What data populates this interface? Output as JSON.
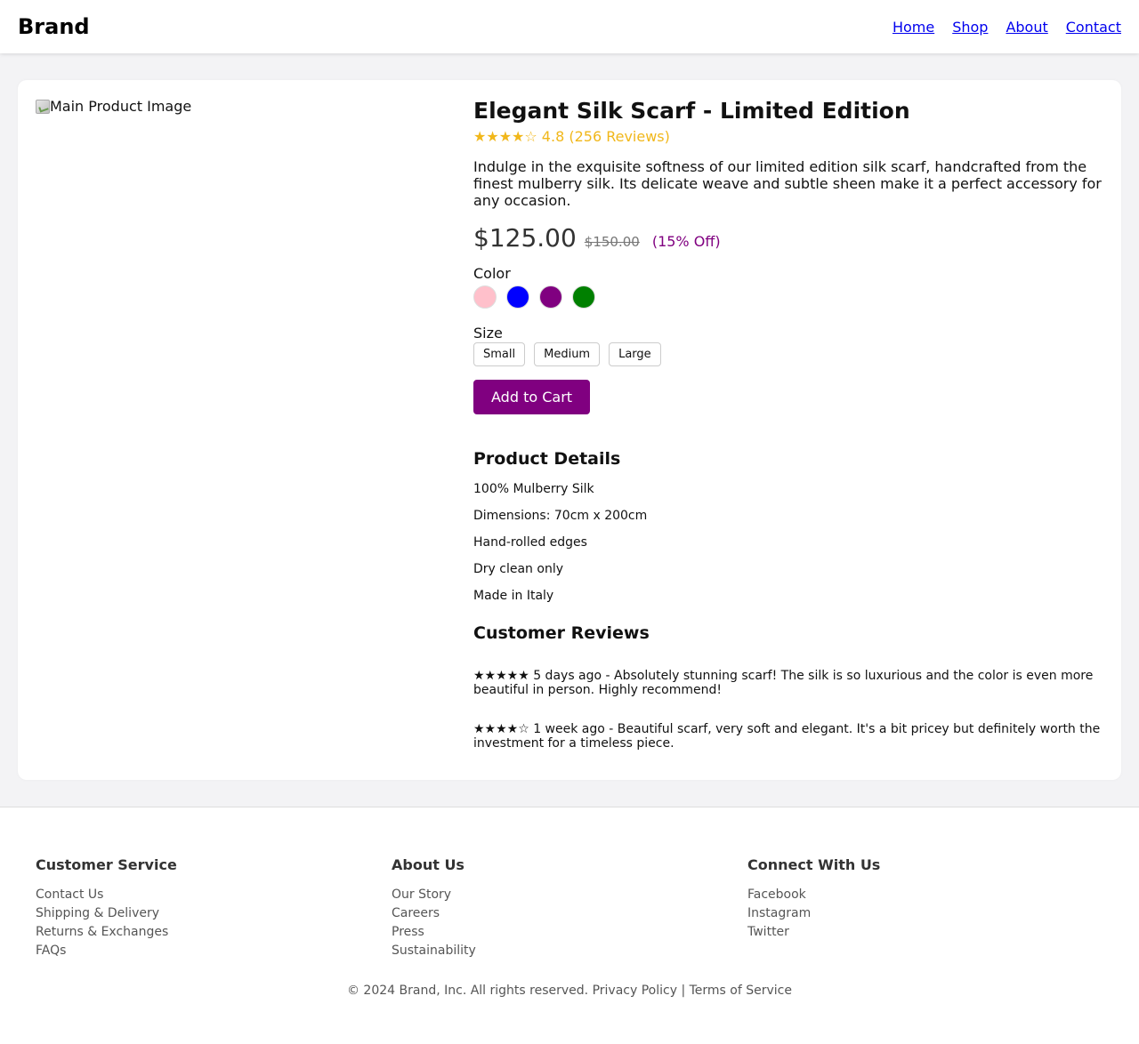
{
  "header": {
    "brand": "Brand",
    "nav": [
      "Home",
      "Shop",
      "About",
      "Contact"
    ]
  },
  "product": {
    "image_alt": "Main Product Image",
    "title": "Elegant Silk Scarf - Limited Edition",
    "rating_text": "★★★★☆ 4.8 (256 Reviews)",
    "description": "Indulge in the exquisite softness of our limited edition silk scarf, handcrafted from the finest mulberry silk. Its delicate weave and subtle sheen make it a perfect accessory for any occasion.",
    "price": "$125.00",
    "old_price": "$150.00",
    "discount": "(15% Off)",
    "color_label": "Color",
    "colors": [
      "#ffc0cb",
      "#0000ff",
      "#800080",
      "#008000"
    ],
    "size_label": "Size",
    "sizes": [
      "Small",
      "Medium",
      "Large"
    ],
    "add_to_cart": "Add to Cart",
    "details_title": "Product Details",
    "details": [
      "100% Mulberry Silk",
      "Dimensions: 70cm x 200cm",
      "Hand-rolled edges",
      "Dry clean only",
      "Made in Italy"
    ],
    "reviews_title": "Customer Reviews",
    "reviews": [
      "★★★★★ 5 days ago - Absolutely stunning scarf! The silk is so luxurious and the color is even more beautiful in person. Highly recommend!",
      "★★★★☆ 1 week ago - Beautiful scarf, very soft and elegant. It's a bit pricey but definitely worth the investment for a timeless piece."
    ]
  },
  "footer": {
    "columns": [
      {
        "title": "Customer Service",
        "links": [
          "Contact Us",
          "Shipping & Delivery",
          "Returns & Exchanges",
          "FAQs"
        ]
      },
      {
        "title": "About Us",
        "links": [
          "Our Story",
          "Careers",
          "Press",
          "Sustainability"
        ]
      },
      {
        "title": "Connect With Us",
        "links": [
          "Facebook",
          "Instagram",
          "Twitter"
        ]
      }
    ],
    "copyright": "© 2024 Brand, Inc. All rights reserved.",
    "privacy": "Privacy Policy",
    "separator": "|",
    "terms": "Terms of Service"
  }
}
